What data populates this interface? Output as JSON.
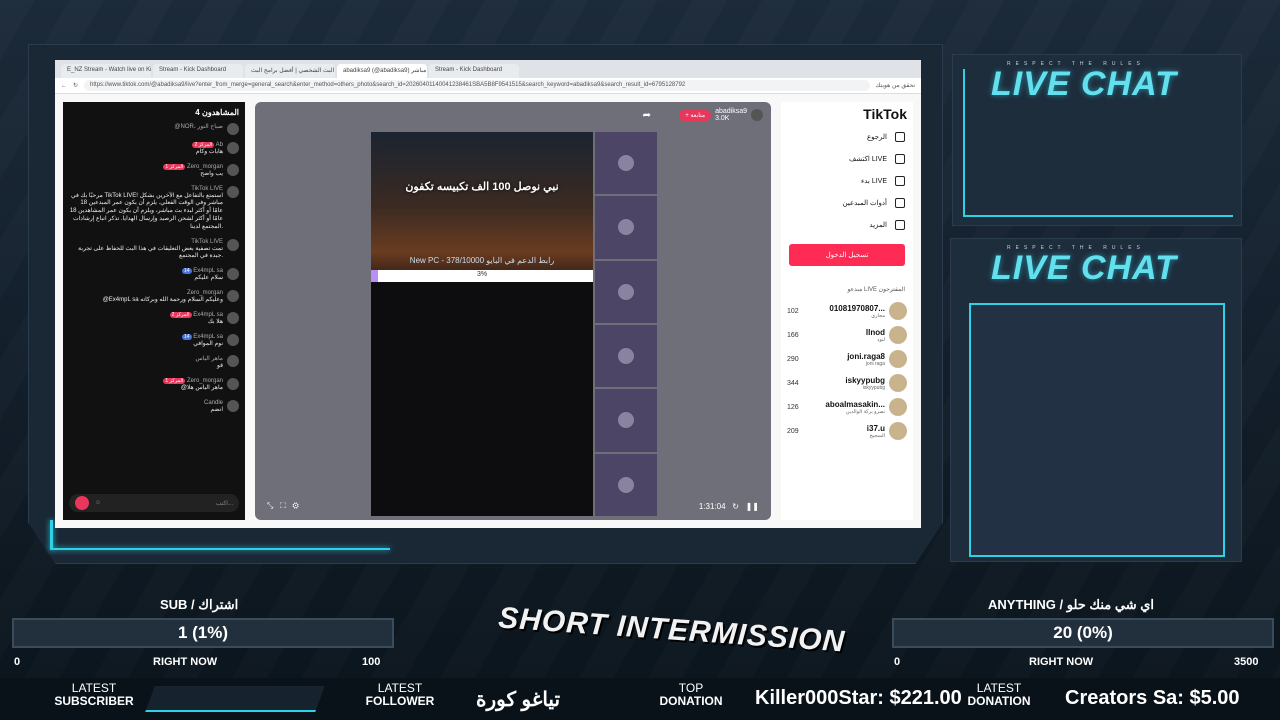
{
  "browser": {
    "tabs": [
      "E_NZ Stream - Watch live on Kick",
      "Stream - Kick Dashboard",
      "البث الشخصي | أفضل برامج البث",
      "abadiksa9 (@abadiksa9) في بث مباشر",
      "Stream - Kick Dashboard"
    ],
    "address": "https://www.tiktok.com/@abadiksa9/live?enter_from_merge=general_search&enter_method=others_photo&search_id=20260401140041238461SBA5B8F9541515&search_keyword=abadiksa9&search_result_id=6795128792",
    "profile_button": "تحقق من هويتك"
  },
  "live_chat": {
    "title": "المشاهدون",
    "viewer_count": "4",
    "messages": [
      {
        "user": "@NOR، صباح النور",
        "badge": "",
        "text": ""
      },
      {
        "user": "Ab",
        "badge": "المركز 2",
        "text": "هايات وكام"
      },
      {
        "user": "Zero_morgan",
        "badge": "المركز 1",
        "text": "يب واضح"
      },
      {
        "user": "TikTok LIVE",
        "badge": "",
        "text": "مرحبًا بك في TikTok LIVE! استمتع بالتفاعل مع الآخرين بشكل مباشر وفي الوقت الفعلي. يلزم أن يكون عمر المبدعين 18 عامًا أو أكثر لبدء بث مباشر، ويلزم أن يكون عمر المشاهدين 18 عامًا أو أكثر لشحن الرصيد وإرسال الهدايا. تذكر اتباع إرشادات المجتمع لدينا."
      },
      {
        "user": "TikTok LIVE",
        "badge": "",
        "text": "تمت تصفية بعض التعليقات في هذا البث للحفاظ على تجربة جيدة في المجتمع."
      },
      {
        "user": "Ex4mpL sa",
        "badge": "14",
        "text": "سلام عليكم"
      },
      {
        "user": "Zero_morgan",
        "badge": "",
        "text": "@Ex4mpL sa وعليكم السلام ورحمة الله وبركاته"
      },
      {
        "user": "Ex4mpL sa",
        "badge": "المركز 2",
        "text": "هلا بك"
      },
      {
        "user": "Ex4mpL sa",
        "badge": "14",
        "text": "نوم الموافي"
      },
      {
        "user": "ماهر الياس",
        "badge": "",
        "text": "قو"
      },
      {
        "user": "Zero_morgan",
        "badge": "المركز 1",
        "text": "@ماهر الياس هلا"
      },
      {
        "user": "Candle",
        "badge": "",
        "text": "انضم"
      }
    ],
    "input_placeholder": "اكتب..."
  },
  "stream": {
    "streamer_name": "abadiksa9",
    "likes": "3.0K",
    "follow_label": "+ متابعة",
    "video_title": "نبي نوصل 100 الف تكبيسه تكفون",
    "goal_text": "New PC - 378/10000 رابط الدعم في البايو",
    "goal_progress": "3%",
    "goal_fraction": 0.03,
    "time": "1:31:04"
  },
  "tiktok_sidebar": {
    "logo": "TikTok",
    "nav": [
      "الرجوع",
      "اكتشف LIVE",
      "بدء LIVE",
      "أدوات المبدعين",
      "المزيد"
    ],
    "login_label": "تسجيل الدخول",
    "suggested_title": "مبدعو LIVE المقترحون",
    "suggested": [
      {
        "name": "01081970807...",
        "sub": "مجاري",
        "count": "102"
      },
      {
        "name": "llnod",
        "sub": "لنود",
        "count": "166"
      },
      {
        "name": "joni.raga8",
        "sub": "joni raga",
        "count": "290"
      },
      {
        "name": "iskyypubg",
        "sub": "iskyypubg",
        "count": "344"
      },
      {
        "name": "aboalmasakin...",
        "sub": "نصرو بركة الوالدين",
        "count": "126"
      },
      {
        "name": "i37.u",
        "sub": "السحيح",
        "count": "209"
      }
    ]
  },
  "right_chat": {
    "tag": "RESPECT THE RULES",
    "title": "LIVE CHAT"
  },
  "goals": {
    "sub": {
      "label": "SUB / اشتراك",
      "value": "1 (1%)",
      "min": "0",
      "max": "100",
      "now": "RIGHT NOW"
    },
    "anything": {
      "label": "ANYTHING / اي شي منك حلو",
      "value": "20 (0%)",
      "min": "0",
      "max": "3500",
      "now": "RIGHT NOW"
    }
  },
  "intermission": "SHORT INTERMISSION",
  "ticker": {
    "latest_subscriber": {
      "l1": "LATEST",
      "l2": "SUBSCRIBER",
      "value": ""
    },
    "latest_follower": {
      "l1": "LATEST",
      "l2": "FOLLOWER",
      "value": "تياغو كورة"
    },
    "top_donation": {
      "l1": "TOP",
      "l2": "DONATION",
      "value": "Killer000Star: $221.00"
    },
    "latest_donation": {
      "l1": "LATEST",
      "l2": "DONATION",
      "value": "Creators Sa: $5.00"
    }
  },
  "colors": {
    "accent": "#2fd1e6",
    "tiktok_red": "#fe2c55"
  }
}
